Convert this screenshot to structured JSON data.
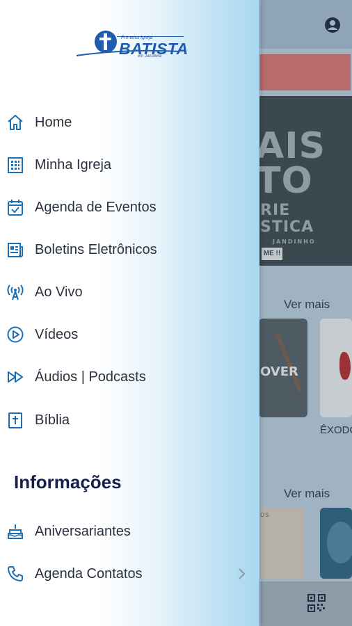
{
  "background": {
    "ver_mais_1": "Ver mais",
    "ver_mais_2": "Ver mais",
    "banner": {
      "line1": "AIS",
      "line2": "TO",
      "line3": "RIE",
      "line4": "STICA",
      "line5": "JANDINHO",
      "badge": "ME !!"
    },
    "card1_text": "OVER",
    "card3_tag": "OS",
    "card2_caption": "ÊXODO",
    "colors": {
      "accent_red": "#b86a6c",
      "overlay": "#9fb3c3"
    }
  },
  "drawer": {
    "logo": {
      "top_text": "Primeira Igreja",
      "main_text": "BATISTA",
      "bottom_text": "em Jacobina",
      "icon": "church-cross-logo"
    },
    "items": [
      {
        "label": "Home",
        "icon": "home-icon"
      },
      {
        "label": "Minha Igreja",
        "icon": "building-icon"
      },
      {
        "label": "Agenda de Eventos",
        "icon": "calendar-check-icon"
      },
      {
        "label": "Boletins Eletrônicos",
        "icon": "newspaper-icon"
      },
      {
        "label": "Ao Vivo",
        "icon": "broadcast-icon"
      },
      {
        "label": "Vídeos",
        "icon": "play-circle-icon"
      },
      {
        "label": "Áudios | Podcasts",
        "icon": "fast-forward-icon"
      },
      {
        "label": "Bíblia",
        "icon": "bible-icon"
      }
    ],
    "section_title": "Informações",
    "info_items": [
      {
        "label": "Aniversariantes",
        "icon": "birthday-cake-icon"
      },
      {
        "label": "Agenda Contatos",
        "icon": "phone-icon",
        "has_chevron": true
      }
    ],
    "colors": {
      "icon": "#1a6fb5",
      "text": "#2a3240",
      "section": "#16204d"
    }
  }
}
